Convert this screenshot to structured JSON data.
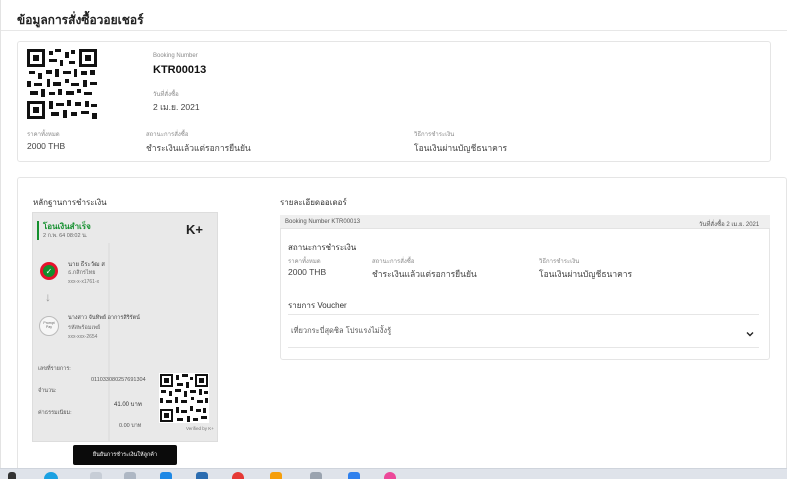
{
  "page_title": "ข้อมูลการสั่งซื้อวอยเชอร์",
  "summary": {
    "booking_number_label": "Booking Number",
    "booking_number": "KTR00013",
    "order_date_label": "วันที่สั่งซื้อ",
    "order_date": "2 เม.ย. 2021",
    "total_label": "ราคาทั้งหมด",
    "total": "2000 THB",
    "order_status_label": "สถานะการสั่งซื้อ",
    "order_status": "ชำระเงินแล้วแต่รอการยืนยัน",
    "payment_method_label": "วิธีการชำระเงิน",
    "payment_method": "โอนเงินผ่านบัญชีธนาคาร"
  },
  "proof": {
    "title": "หลักฐานการชำระเงิน",
    "slip": {
      "status": "โอนเงินสำเร็จ",
      "datetime": "2 ก.พ. 64 08:02 น.",
      "brand": "K+",
      "sender_name": "นาย ธีระวัฒ ส",
      "sender_bank": "ธ.กสิกรไทย",
      "sender_account": "xxx-x-x1761-x",
      "receiver_name": "นางสาว จันทิพย์ อาการสิริรัตน์",
      "receiver_bank": "รหัสพร้อมเพย์",
      "receiver_account": "xxx-xxx-2654",
      "promptpay": "Prompt Pay",
      "ref_label": "เลขที่รายการ:",
      "ref": "011033080257691304",
      "amount_label": "จำนวน:",
      "amount": "41.00 บาท",
      "fee_label": "ค่าธรรมเนียม:",
      "fee": "0.00 บาท",
      "verified": "Verified by K+"
    },
    "confirm_button": "ยืนยันการชำระเงินให้ลูกค้า"
  },
  "order_detail": {
    "title": "รายละเอียดออเดอร์",
    "header_booking": "Booking Number KTR00013",
    "header_date": "วันที่สั่งซื้อ 2 เม.ย. 2021",
    "payment_status_title": "สถานะการชำระเงิน",
    "total_label": "ราคาทั้งหมด",
    "total": "2000 THB",
    "order_status_label": "สถานะการสั่งซื้อ",
    "order_status": "ชำระเงินแล้วแต่รอการยืนยัน",
    "payment_method_label": "วิธีการชำระเงิน",
    "payment_method": "โอนเงินผ่านบัญชีธนาคาร",
    "voucher_title": "รายการ Voucher",
    "voucher_item": "เที่ยวกระบี่สุดชิล โปรแรงไม่งั้งรู้"
  },
  "colors": {
    "kbank_green": "#138f2d",
    "kplus_dark": "#222222"
  }
}
